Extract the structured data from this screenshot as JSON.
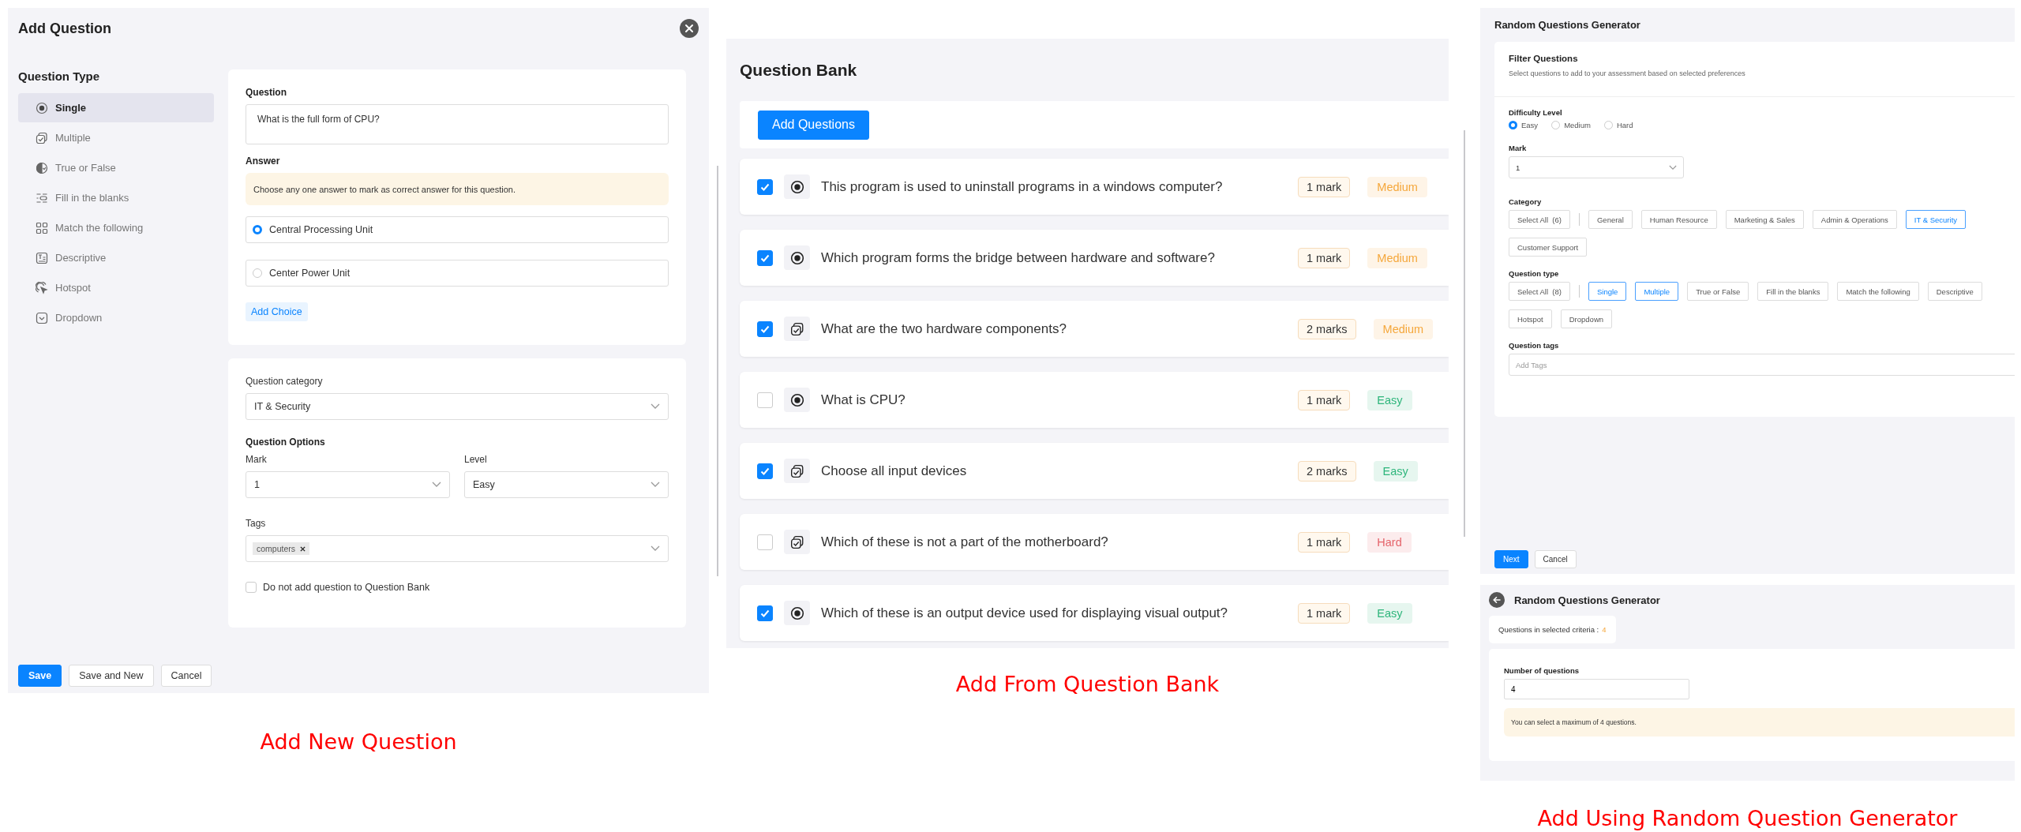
{
  "add_new_question": {
    "title": "Add Question",
    "question_type": {
      "heading": "Question Type",
      "items": [
        {
          "label": "Single",
          "kind": "single",
          "selected": true
        },
        {
          "label": "Multiple",
          "kind": "multiple",
          "selected": false
        },
        {
          "label": "True or False",
          "kind": "truefalse",
          "selected": false
        },
        {
          "label": "Fill in the blanks",
          "kind": "blanks",
          "selected": false
        },
        {
          "label": "Match the following",
          "kind": "match",
          "selected": false
        },
        {
          "label": "Descriptive",
          "kind": "descriptive",
          "selected": false
        },
        {
          "label": "Hotspot",
          "kind": "hotspot",
          "selected": false
        },
        {
          "label": "Dropdown",
          "kind": "dropdown",
          "selected": false
        }
      ]
    },
    "question": {
      "label": "Question",
      "value": "What is the full form of CPU?"
    },
    "answer": {
      "label": "Answer",
      "hint": "Choose any one answer to mark as correct answer for this question.",
      "choices": [
        {
          "text": "Central Processing Unit",
          "selected": true
        },
        {
          "text": "Center Power Unit",
          "selected": false
        }
      ],
      "add_choice": "Add Choice"
    },
    "category": {
      "label": "Question category",
      "value": "IT & Security"
    },
    "options": {
      "heading": "Question Options",
      "mark": {
        "label": "Mark",
        "value": "1"
      },
      "level": {
        "label": "Level",
        "value": "Easy"
      }
    },
    "tags": {
      "label": "Tags",
      "chips": [
        "computers"
      ]
    },
    "exclude": {
      "label": "Do not add question to Question Bank",
      "checked": false
    },
    "buttons": [
      {
        "label": "Save",
        "kind": "primary"
      },
      {
        "label": "Save and New",
        "kind": "secondary"
      },
      {
        "label": "Cancel",
        "kind": "secondary"
      }
    ],
    "caption": "Add New Question"
  },
  "question_bank": {
    "title": "Question Bank",
    "add_button": "Add Questions",
    "rows": [
      {
        "checked": true,
        "kind": "single",
        "text": "This program is used to uninstall programs in a windows computer?",
        "mark": "1 mark",
        "level": "Medium",
        "color": "#f5a73b"
      },
      {
        "checked": true,
        "kind": "single",
        "text": "Which program forms the bridge between hardware and software?",
        "mark": "1 mark",
        "level": "Medium",
        "color": "#f5a73b"
      },
      {
        "checked": true,
        "kind": "multiple",
        "text": "What are the two hardware components?",
        "mark": "2 marks",
        "level": "Medium",
        "color": "#f5a73b"
      },
      {
        "checked": false,
        "kind": "single",
        "text": "What is CPU?",
        "mark": "1 mark",
        "level": "Easy",
        "color": "#2fb67c"
      },
      {
        "checked": true,
        "kind": "multiple",
        "text": "Choose all input devices",
        "mark": "2 marks",
        "level": "Easy",
        "color": "#2fb67c"
      },
      {
        "checked": false,
        "kind": "multiple",
        "text": "Which of these is not a part of the motherboard?",
        "mark": "1 mark",
        "level": "Hard",
        "color": "#e5646b"
      },
      {
        "checked": true,
        "kind": "single",
        "text": "Which of these is an output device used for displaying visual output?",
        "mark": "1 mark",
        "level": "Easy",
        "color": "#2fb67c"
      }
    ],
    "caption": "Add From Question Bank"
  },
  "random_generator": {
    "title": "Random Questions Generator",
    "filter": {
      "heading": "Filter Questions",
      "description": "Select questions to add to your assessment based on selected preferences"
    },
    "difficulty": {
      "label": "Difficulty Level",
      "options": [
        {
          "label": "Easy",
          "selected": true
        },
        {
          "label": "Medium",
          "selected": false
        },
        {
          "label": "Hard",
          "selected": false
        }
      ]
    },
    "mark": {
      "label": "Mark",
      "value": "1"
    },
    "category": {
      "label": "Category",
      "select_all": "Select All  (6)",
      "chips": [
        {
          "label": "General",
          "selected": false
        },
        {
          "label": "Human Resource",
          "selected": false
        },
        {
          "label": "Marketing & Sales",
          "selected": false
        },
        {
          "label": "Admin & Operations",
          "selected": false
        },
        {
          "label": "IT & Security",
          "selected": true
        },
        {
          "label": "Customer Support",
          "selected": false
        }
      ]
    },
    "question_type": {
      "label": "Question type",
      "select_all": "Select All  (8)",
      "chips": [
        {
          "label": "Single",
          "selected": true
        },
        {
          "label": "Multiple",
          "selected": true
        },
        {
          "label": "True or False",
          "selected": false
        },
        {
          "label": "Fill in the blanks",
          "selected": false
        },
        {
          "label": "Match the following",
          "selected": false
        },
        {
          "label": "Descriptive",
          "selected": false
        },
        {
          "label": "Hotspot",
          "selected": false
        },
        {
          "label": "Dropdown",
          "selected": false
        }
      ]
    },
    "tags": {
      "label": "Question tags",
      "placeholder": "Add Tags"
    },
    "buttons": [
      {
        "label": "Next",
        "kind": "primary"
      },
      {
        "label": "Cancel",
        "kind": "secondary"
      }
    ],
    "result": {
      "title": "Random Questions Generator",
      "criteria_label": "Questions in selected criteria :",
      "criteria_count": "4",
      "number_label": "Number of questions",
      "number_value": "4",
      "notice": "You can select a maximum of 4 questions."
    },
    "caption": "Add Using Random Question Generator"
  }
}
